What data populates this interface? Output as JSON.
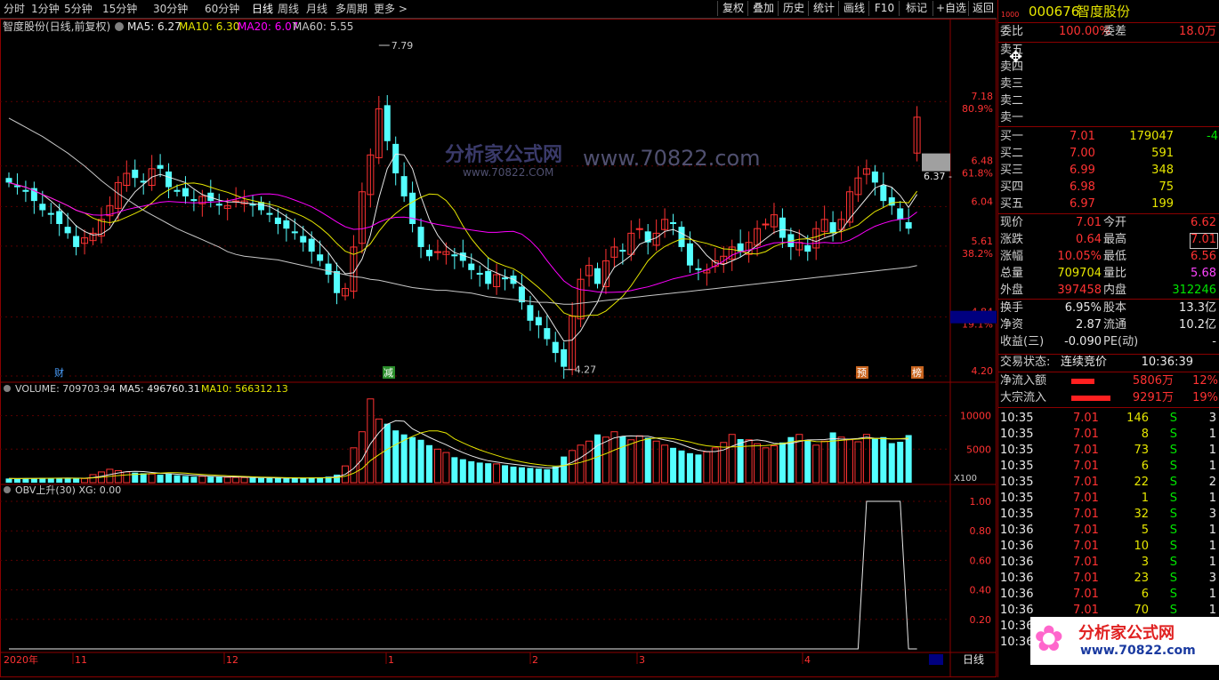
{
  "toolbar": {
    "periods": [
      "分时",
      "1分钟",
      "5分钟",
      "15分钟",
      "30分钟",
      "60分钟",
      "日线",
      "周线",
      "月线",
      "多周期",
      "更多 >"
    ],
    "active_period": "日线",
    "buttons": [
      "复权",
      "叠加",
      "历史",
      "统计",
      "画线",
      "F10",
      "标记",
      "+自选",
      "返回"
    ]
  },
  "main_chart": {
    "title": "智度股份(日线,前复权)",
    "ma_labels": [
      {
        "text": "MA5: 6.27",
        "color": "#e8e8e8"
      },
      {
        "text": "MA10: 6.30",
        "color": "#e6e600"
      },
      {
        "text": "MA20: 6.07",
        "color": "#ff00ff"
      },
      {
        "text": "MA60: 5.55",
        "color": "#c8c8c8"
      }
    ],
    "y_ticks": [
      {
        "price": "7.18",
        "pct": "80.9%"
      },
      {
        "price": "6.48",
        "pct": "61.8%"
      },
      {
        "price": "6.04",
        "pct": ""
      },
      {
        "price": "5.61",
        "pct": "38.2%"
      },
      {
        "price": "4.84",
        "pct": "19.1%"
      },
      {
        "price": "4.20",
        "pct": ""
      }
    ],
    "high_marker": "7.79",
    "low_marker": "4.27",
    "cursor_value": "6.37",
    "event_marks": [
      "财",
      "减",
      "预",
      "榜"
    ],
    "watermark": {
      "logo": "分析家公式网",
      "site": "www.70822.com",
      "sub": "www.70822.COM"
    }
  },
  "volume_chart": {
    "labels": [
      {
        "text": "VOLUME: 709703.94",
        "color": "#d0d0d0"
      },
      {
        "text": "MA5: 496760.31",
        "color": "#e8e8e8"
      },
      {
        "text": "MA10: 566312.13",
        "color": "#e6e600"
      }
    ],
    "y_ticks": [
      "10000",
      "5000"
    ],
    "unit": "X100"
  },
  "obv_chart": {
    "label": "OBV上升(30) XG: 0.00",
    "y_ticks": [
      "1.00",
      "0.80",
      "0.60",
      "0.40",
      "0.20"
    ]
  },
  "x_axis": {
    "labels": [
      "2020年",
      "11",
      "12",
      "1",
      "2",
      "3",
      "4"
    ],
    "period_label": "日线"
  },
  "chart_data": {
    "type": "candlestick",
    "series_name": "智度股份",
    "price_range": [
      4.2,
      7.79
    ],
    "close": [
      6.3,
      6.25,
      6.2,
      6.1,
      6.0,
      5.95,
      5.85,
      5.75,
      5.6,
      5.7,
      5.75,
      5.9,
      6.05,
      6.3,
      6.4,
      6.35,
      6.3,
      6.45,
      6.45,
      6.25,
      6.2,
      6.15,
      6.1,
      6.15,
      6.1,
      6.05,
      6.05,
      6.1,
      6.1,
      6.05,
      6.0,
      5.95,
      5.85,
      5.8,
      5.75,
      5.65,
      5.55,
      5.45,
      5.3,
      5.1,
      5.15,
      5.6,
      6.2,
      6.6,
      7.1,
      6.75,
      6.4,
      6.15,
      5.85,
      5.6,
      5.5,
      5.55,
      5.55,
      5.5,
      5.45,
      5.35,
      5.3,
      5.2,
      5.3,
      5.25,
      5.2,
      5.0,
      4.8,
      4.75,
      4.6,
      4.45,
      4.3,
      4.85,
      5.25,
      5.4,
      5.2,
      5.45,
      5.6,
      5.55,
      5.75,
      5.8,
      5.65,
      5.75,
      5.9,
      5.85,
      5.6,
      5.4,
      5.35,
      5.35,
      5.45,
      5.5,
      5.6,
      5.55,
      5.65,
      5.8,
      5.85,
      5.95,
      5.7,
      5.6,
      5.65,
      5.55,
      5.8,
      5.9,
      5.75,
      5.9,
      6.2,
      6.35,
      6.45,
      6.3,
      6.1,
      6.05,
      5.9,
      5.8,
      7.01
    ],
    "volume": [
      620,
      600,
      640,
      660,
      700,
      720,
      680,
      660,
      640,
      620,
      1200,
      1600,
      2000,
      1800,
      1600,
      1500,
      1400,
      1300,
      1200,
      1300,
      1100,
      1000,
      900,
      950,
      900,
      850,
      800,
      780,
      760,
      720,
      700,
      680,
      660,
      640,
      700,
      720,
      760,
      800,
      900,
      1200,
      2500,
      5200,
      7600,
      12500,
      9500,
      8800,
      7800,
      7200,
      6800,
      6400,
      5600,
      5000,
      4500,
      3800,
      3500,
      3200,
      3000,
      2900,
      2800,
      2600,
      2400,
      2300,
      2200,
      2100,
      2000,
      2400,
      3900,
      4800,
      5600,
      6200,
      7200,
      6800,
      7600,
      6900,
      6400,
      7000,
      6700,
      6200,
      5600,
      5200,
      4800,
      4400,
      4200,
      4600,
      5200,
      6000,
      7200,
      6500,
      6400,
      5800,
      5200,
      5500,
      6000,
      6800,
      7200,
      6400,
      5600,
      6200,
      7500,
      6800,
      6400,
      6100,
      7200,
      6600,
      6800,
      5900,
      6100,
      7097
    ],
    "ma60": [
      7.0,
      6.95,
      6.9,
      6.85,
      6.8,
      6.74,
      6.68,
      6.62,
      6.55,
      6.48,
      6.4,
      6.32,
      6.25,
      6.18,
      6.12,
      6.06,
      6.0,
      5.95,
      5.9,
      5.85,
      5.8,
      5.76,
      5.72,
      5.68,
      5.64,
      5.6,
      5.55,
      5.52,
      5.5,
      5.49,
      5.48,
      5.47,
      5.46,
      5.44,
      5.42,
      5.4,
      5.38,
      5.36,
      5.34,
      5.32,
      5.3,
      5.28,
      5.27,
      5.25,
      5.24,
      5.22,
      5.2,
      5.18,
      5.16,
      5.15,
      5.14,
      5.13,
      5.13,
      5.12,
      5.11,
      5.1,
      5.08,
      5.06,
      5.05,
      5.04,
      5.03,
      5.02,
      5.01,
      5.0,
      5.0,
      4.99,
      4.98,
      4.98,
      4.99,
      5.0,
      5.01,
      5.02,
      5.03,
      5.04,
      5.05,
      5.06,
      5.07,
      5.08,
      5.09,
      5.1,
      5.11,
      5.12,
      5.13,
      5.14,
      5.15,
      5.16,
      5.17,
      5.18,
      5.19,
      5.2,
      5.21,
      5.22,
      5.23,
      5.24,
      5.25,
      5.26,
      5.27,
      5.28,
      5.29,
      5.3,
      5.31,
      5.32,
      5.33,
      5.34,
      5.35,
      5.36,
      5.37,
      5.38,
      5.4
    ],
    "obv_signal": [
      0,
      0,
      0,
      0,
      0,
      0,
      0,
      0,
      0,
      0,
      0,
      0,
      0,
      0,
      0,
      0,
      0,
      0,
      0,
      0,
      0,
      0,
      0,
      0,
      0,
      0,
      0,
      0,
      0,
      0,
      0,
      0,
      0,
      0,
      0,
      0,
      0,
      0,
      0,
      0,
      0,
      0,
      0,
      0,
      0,
      0,
      0,
      0,
      0,
      0,
      0,
      0,
      0,
      0,
      0,
      0,
      0,
      0,
      0,
      0,
      0,
      0,
      0,
      0,
      0,
      0,
      0,
      0,
      0,
      0,
      0,
      0,
      0,
      0,
      0,
      0,
      0,
      0,
      0,
      0,
      0,
      0,
      0,
      0,
      0,
      0,
      0,
      0,
      0,
      0,
      0,
      0,
      0,
      0,
      0,
      0,
      0,
      0,
      0,
      0,
      0,
      0,
      1,
      1,
      1,
      1,
      1,
      0,
      0
    ]
  },
  "right_panel": {
    "code": "000676",
    "name": "智度股份",
    "weibi": {
      "label": "委比",
      "value": "100.00%",
      "label2": "委差",
      "value2": "18.0万"
    },
    "asks": [
      {
        "label": "卖五",
        "price": "",
        "vol": ""
      },
      {
        "label": "卖四",
        "price": "",
        "vol": ""
      },
      {
        "label": "卖三",
        "price": "",
        "vol": ""
      },
      {
        "label": "卖二",
        "price": "",
        "vol": ""
      },
      {
        "label": "卖一",
        "price": "",
        "vol": ""
      }
    ],
    "bids": [
      {
        "label": "买一",
        "price": "7.01",
        "vol": "179047",
        "chg": "-4"
      },
      {
        "label": "买二",
        "price": "7.00",
        "vol": "591",
        "chg": ""
      },
      {
        "label": "买三",
        "price": "6.99",
        "vol": "348",
        "chg": ""
      },
      {
        "label": "买四",
        "price": "6.98",
        "vol": "75",
        "chg": ""
      },
      {
        "label": "买五",
        "price": "6.97",
        "vol": "199",
        "chg": ""
      }
    ],
    "stats": [
      {
        "l1": "现价",
        "v1": "7.01",
        "c1": "red",
        "l2": "今开",
        "v2": "6.62",
        "c2": "red"
      },
      {
        "l1": "涨跌",
        "v1": "0.64",
        "c1": "red",
        "l2": "最高",
        "v2": "7.01",
        "c2": "red"
      },
      {
        "l1": "涨幅",
        "v1": "10.05%",
        "c1": "red",
        "l2": "最低",
        "v2": "6.56",
        "c2": "red"
      },
      {
        "l1": "总量",
        "v1": "709704",
        "c1": "yel",
        "l2": "量比",
        "v2": "5.68",
        "c2": "mag"
      },
      {
        "l1": "外盘",
        "v1": "397458",
        "c1": "red",
        "l2": "内盘",
        "v2": "312246",
        "c2": "green"
      }
    ],
    "stats2": [
      {
        "l1": "换手",
        "v1": "6.95%",
        "l2": "股本",
        "v2": "13.3亿"
      },
      {
        "l1": "净资",
        "v1": "2.87",
        "l2": "流通",
        "v2": "10.2亿"
      },
      {
        "l1": "收益(三)",
        "v1": "-0.090",
        "l2": "PE(动)",
        "v2": "-"
      }
    ],
    "trade_status": {
      "label": "交易状态:",
      "value": "连续竞价",
      "time": "10:36:39"
    },
    "flows": [
      {
        "label": "净流入额",
        "value": "5806万",
        "pct": "12%"
      },
      {
        "label": "大宗流入",
        "value": "9291万",
        "pct": "19%"
      }
    ],
    "ticks": [
      {
        "time": "10:35",
        "price": "7.01",
        "vol": "146",
        "side": "S",
        "n": "3"
      },
      {
        "time": "10:35",
        "price": "7.01",
        "vol": "8",
        "side": "S",
        "n": "1"
      },
      {
        "time": "10:35",
        "price": "7.01",
        "vol": "73",
        "side": "S",
        "n": "1"
      },
      {
        "time": "10:35",
        "price": "7.01",
        "vol": "6",
        "side": "S",
        "n": "1"
      },
      {
        "time": "10:35",
        "price": "7.01",
        "vol": "22",
        "side": "S",
        "n": "2"
      },
      {
        "time": "10:35",
        "price": "7.01",
        "vol": "1",
        "side": "S",
        "n": "1"
      },
      {
        "time": "10:35",
        "price": "7.01",
        "vol": "32",
        "side": "S",
        "n": "3"
      },
      {
        "time": "10:36",
        "price": "7.01",
        "vol": "5",
        "side": "S",
        "n": "1"
      },
      {
        "time": "10:36",
        "price": "7.01",
        "vol": "10",
        "side": "S",
        "n": "1"
      },
      {
        "time": "10:36",
        "price": "7.01",
        "vol": "3",
        "side": "S",
        "n": "1"
      },
      {
        "time": "10:36",
        "price": "7.01",
        "vol": "23",
        "side": "S",
        "n": "3"
      },
      {
        "time": "10:36",
        "price": "7.01",
        "vol": "6",
        "side": "S",
        "n": "1"
      },
      {
        "time": "10:36",
        "price": "7.01",
        "vol": "70",
        "side": "S",
        "n": "1"
      },
      {
        "time": "10:36",
        "price": "",
        "vol": "",
        "side": "",
        "n": ""
      },
      {
        "time": "10:36",
        "price": "",
        "vol": "",
        "side": "",
        "n": ""
      }
    ],
    "footer_logo": "分析家公式网",
    "footer_site": "www.70822.com"
  }
}
